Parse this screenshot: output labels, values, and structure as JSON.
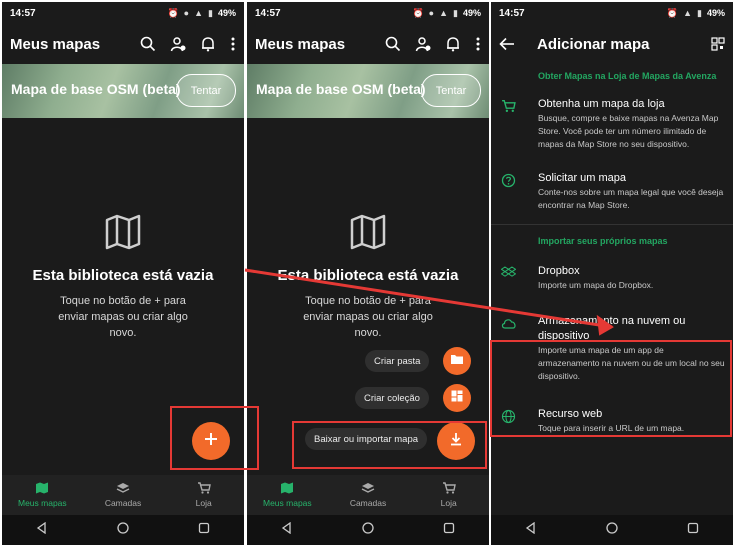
{
  "status": {
    "time": "14:57",
    "battery": "49%"
  },
  "screen1": {
    "title": "Meus mapas",
    "banner_text": "Mapa de base OSM (beta)",
    "banner_button": "Tentar",
    "empty_title": "Esta biblioteca está vazia",
    "empty_desc": "Toque no botão de + para enviar mapas ou criar algo novo.",
    "nav": [
      "Meus mapas",
      "Camadas",
      "Loja"
    ]
  },
  "screen2": {
    "title": "Meus mapas",
    "banner_text": "Mapa de base OSM (beta)",
    "banner_button": "Tentar",
    "empty_title": "Esta biblioteca está vazia",
    "empty_desc": "Toque no botão de + para enviar mapas ou criar algo novo.",
    "fab_menu": [
      "Criar pasta",
      "Criar coleção",
      "Baixar ou importar mapa"
    ],
    "nav": [
      "Meus mapas",
      "Camadas",
      "Loja"
    ]
  },
  "screen3": {
    "title": "Adicionar mapa",
    "section_store": "Obter Mapas na Loja de Mapas da Avenza",
    "store_title": "Obtenha um mapa da loja",
    "store_desc": "Busque, compre e baixe mapas na Avenza Map Store. Você pode ter um número ilimitado de mapas da Map Store no seu dispositivo.",
    "request_title": "Solicitar um mapa",
    "request_desc": "Conte-nos sobre um mapa legal que você deseja encontrar na Map Store.",
    "section_import": "Importar seus próprios mapas",
    "dropbox_title": "Dropbox",
    "dropbox_desc": "Importe um mapa do Dropbox.",
    "cloud_title": "Armazenamento na nuvem ou dispositivo",
    "cloud_desc": "Importe uma mapa de um app de armazenamento na nuvem ou de um local no seu dispositivo.",
    "web_title": "Recurso web",
    "web_desc": "Toque para inserir a URL de um mapa."
  },
  "colors": {
    "accent": "#f26a2a",
    "green": "#27b36b",
    "background": "#1b1b1b",
    "highlight": "#e53935"
  },
  "icons": [
    "search-icon",
    "profile-icon",
    "bell-icon",
    "more-icon",
    "map-icon",
    "plus-icon",
    "folder-icon",
    "collection-icon",
    "download-icon",
    "back-icon",
    "qr-icon",
    "cart-icon",
    "help-icon",
    "dropbox-icon",
    "cloud-icon",
    "globe-icon"
  ]
}
